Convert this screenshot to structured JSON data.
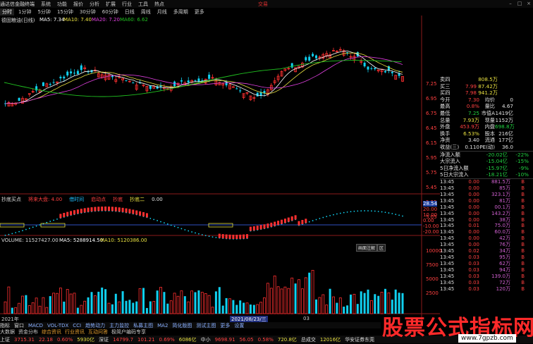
{
  "app": {
    "title": "通达信金融终端",
    "menus": [
      "系统",
      "功能",
      "报价",
      "分析",
      "扩展",
      "行业",
      "工具",
      "热点"
    ],
    "trade_label": "交易"
  },
  "periods": {
    "items": [
      "分时",
      "1分钟",
      "5分钟",
      "15分钟",
      "30分钟",
      "60分钟",
      "日线",
      "周线",
      "月线",
      "多周期",
      "更多"
    ],
    "selected": 0
  },
  "main_chart": {
    "header_stock": "德固粮油(日线)",
    "ma5": "MA5: 7.34",
    "ma10": "MA10: 7.40",
    "ma20": "MA20: 7.20",
    "ma60": "MA60: 6.62",
    "y_ticks": [
      "7.25",
      "6.95",
      "6.75",
      "6.45",
      "6.15",
      "5.95",
      "5.75",
      "5.45",
      "5.25",
      "5.05"
    ]
  },
  "indicator": {
    "name": "抄底买点",
    "items": [
      {
        "text": "将来大盘: 4.00",
        "color": "#ff4040"
      },
      {
        "text": "借时间",
        "color": "#20c0ff"
      },
      {
        "text": "启动点",
        "color": "#ff4040"
      },
      {
        "text": "抄底",
        "color": "#ff4040"
      },
      {
        "text": "抄底二",
        "color": "#e8e040"
      },
      {
        "text": "0.00",
        "color": "#e0e0e0"
      }
    ],
    "y_ticks": [
      "28.54",
      "20.00",
      "10.00",
      "0.00",
      "-10.00",
      "-20.00"
    ]
  },
  "volume": {
    "label": "VOLUME: 11527427.00",
    "ma5": "MA5: 5288914.50",
    "ma10": "MA10: 5120386.00",
    "y_ticks": [
      "10000",
      "7500",
      "5000",
      "2500"
    ],
    "buttons": [
      "画面注解",
      "区"
    ],
    "dates": [
      "2021年",
      "2021/08/23/三"
    ],
    "dates_extra": "03"
  },
  "quote": {
    "asks": [
      {
        "label": "卖四",
        "price": "",
        "vol": "808.5万"
      },
      {
        "label": "买三",
        "price": "7.99",
        "vol": "87.42万"
      },
      {
        "label": "买四",
        "price": "7.98",
        "vol": "941.2万"
      }
    ],
    "summary": [
      {
        "l1": "今开",
        "v1": "7.30",
        "c1": "red",
        "l2": "均价",
        "v2": "0",
        "c2": "white"
      },
      {
        "l1": "最高",
        "v1": "0.8%",
        "c1": "red",
        "l2": "量比",
        "v2": "4.67",
        "c2": "white"
      },
      {
        "l1": "最低",
        "v1": "7.25",
        "c1": "green",
        "l2": "市值A",
        "v2": "1419亿",
        "c2": "white"
      },
      {
        "l1": "总量",
        "v1": "7.93万",
        "c1": "yellow",
        "l2": "现量",
        "v2": "1152万",
        "c2": "white"
      },
      {
        "l1": "外盘",
        "v1": "453.9万",
        "c1": "red",
        "l2": "内盘",
        "v2": "698.8万",
        "c2": "green"
      },
      {
        "l1": "换手",
        "v1": "6.53%",
        "c1": "yellow",
        "l2": "股本",
        "v2": "216亿",
        "c2": "white"
      },
      {
        "l1": "净资",
        "v1": "3.40",
        "c1": "white",
        "l2": "流通",
        "v2": "177亿",
        "c2": "white"
      },
      {
        "l1": "收益(三)",
        "v1": "0.110",
        "c1": "white",
        "l2": "PE(动)",
        "v2": "36.0",
        "c2": "white"
      }
    ],
    "flows": [
      {
        "label": "净流入额",
        "value": "-20.02亿",
        "pct": "-22%"
      },
      {
        "label": "大宗流入",
        "value": "-15.04亿",
        "pct": "-15%"
      },
      {
        "label": "5日净流入额",
        "value": "-15.97亿",
        "pct": "-9%"
      },
      {
        "label": "5日大宗流入",
        "value": "-18.21亿",
        "pct": "-10%"
      }
    ],
    "ticks": [
      {
        "t": "13:45",
        "p": "0.00",
        "v": "881.5万",
        "d": "B"
      },
      {
        "t": "13:45",
        "p": "0.00",
        "v": "85万",
        "d": "B"
      },
      {
        "t": "13:45",
        "p": "0.00",
        "v": "323.1万",
        "d": "B"
      },
      {
        "t": "13:45",
        "p": "0.00",
        "v": "81万",
        "d": "B"
      },
      {
        "t": "13:45",
        "p": "0.00",
        "v": "00.1万",
        "d": "B"
      },
      {
        "t": "13:45",
        "p": "0.00",
        "v": "143.2万",
        "d": "B"
      },
      {
        "t": "13:45",
        "p": "0.00",
        "v": "38万",
        "d": "B"
      },
      {
        "t": "13:45",
        "p": "0.01",
        "v": "75.0万",
        "d": "B"
      },
      {
        "t": "13:45",
        "p": "0.00",
        "v": "60.0万",
        "d": "B"
      },
      {
        "t": "13:45",
        "p": "0.00",
        "v": "42万",
        "d": "B"
      },
      {
        "t": "13:45",
        "p": "0.00",
        "v": "76万",
        "d": "B"
      },
      {
        "t": "13:45",
        "p": "0.02",
        "v": "34万",
        "d": "B"
      },
      {
        "t": "13:45",
        "p": "0.03",
        "v": "95万",
        "d": "B"
      },
      {
        "t": "13:45",
        "p": "0.03",
        "v": "62万",
        "d": "B"
      },
      {
        "t": "13:45",
        "p": "0.03",
        "v": "94万",
        "d": "B"
      },
      {
        "t": "13:45",
        "p": "0.03",
        "v": "139.0万",
        "d": "B"
      },
      {
        "t": "13:45",
        "p": "0.03",
        "v": "72万",
        "d": "B"
      },
      {
        "t": "13:45",
        "p": "0.03",
        "v": "120万",
        "d": "B"
      }
    ]
  },
  "bottom_tabs": [
    "指标",
    "窗口",
    "MACD",
    "VOL-TDX",
    "CCI",
    "趋势动力",
    "主力监控",
    "私募主图",
    "MA2",
    "简化版图",
    "测试主图",
    "更多",
    "设置"
  ],
  "func_tabs": [
    "大数据",
    "资金分布",
    "综合资讯",
    "行业资讯",
    "互动问答",
    "极简户编码专享"
  ],
  "status": [
    {
      "text": "上证",
      "color": "#e0e0e0"
    },
    {
      "text": "3715.31",
      "color": "#ff4040"
    },
    {
      "text": "22.18",
      "color": "#ff4040"
    },
    {
      "text": "0.60%",
      "color": "#ff4040"
    },
    {
      "text": "5930亿",
      "color": "#e8e040"
    },
    {
      "text": "深证",
      "color": "#e0e0e0"
    },
    {
      "text": "14799.7",
      "color": "#ff4040"
    },
    {
      "text": "101.21",
      "color": "#ff4040"
    },
    {
      "text": "0.69%",
      "color": "#ff4040"
    },
    {
      "text": "6086亿",
      "color": "#e8e040"
    },
    {
      "text": "中小",
      "color": "#e0e0e0"
    },
    {
      "text": "9698.91",
      "color": "#ff4040"
    },
    {
      "text": "56.05",
      "color": "#ff4040"
    },
    {
      "text": "0.58%",
      "color": "#ff4040"
    },
    {
      "text": "720.8亿",
      "color": "#e8e040"
    },
    {
      "text": "总成交",
      "color": "#e0e0e0"
    },
    {
      "text": "12016亿",
      "color": "#e8e040"
    },
    {
      "text": "华安证券东莞",
      "color": "#e0e0e0"
    }
  ],
  "watermark": {
    "text": "股票公式指标网",
    "url": "www.7gpzb.com"
  },
  "colors": {
    "up": "#ff3030",
    "down": "#10d0f0",
    "ma5": "#ffffff",
    "ma10": "#e8e040",
    "ma20": "#e040e0",
    "ma60": "#20c020"
  }
}
